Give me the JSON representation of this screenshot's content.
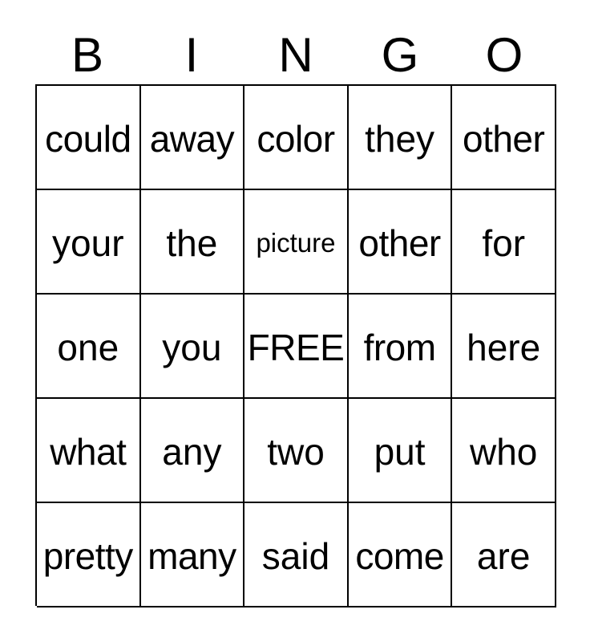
{
  "card": {
    "header_letters": [
      "B",
      "I",
      "N",
      "G",
      "O"
    ],
    "free_space_label": "FREE",
    "colors": {
      "background": "#ffffff",
      "border": "#000000",
      "text": "#000000"
    },
    "rows": [
      [
        {
          "text": "could",
          "size": "tight"
        },
        {
          "text": "away",
          "size": "tight"
        },
        {
          "text": "color",
          "size": "tight"
        },
        {
          "text": "they",
          "size": "normal"
        },
        {
          "text": "other",
          "size": "tight"
        }
      ],
      [
        {
          "text": "your",
          "size": "normal"
        },
        {
          "text": "the",
          "size": "normal"
        },
        {
          "text": "picture",
          "size": "shrink"
        },
        {
          "text": "other",
          "size": "tight"
        },
        {
          "text": "for",
          "size": "normal"
        }
      ],
      [
        {
          "text": "one",
          "size": "normal"
        },
        {
          "text": "you",
          "size": "normal"
        },
        {
          "text": "FREE",
          "size": "tight"
        },
        {
          "text": "from",
          "size": "tight"
        },
        {
          "text": "here",
          "size": "normal"
        }
      ],
      [
        {
          "text": "what",
          "size": "tight"
        },
        {
          "text": "any",
          "size": "normal"
        },
        {
          "text": "two",
          "size": "normal"
        },
        {
          "text": "put",
          "size": "normal"
        },
        {
          "text": "who",
          "size": "normal"
        }
      ],
      [
        {
          "text": "pretty",
          "size": "tight"
        },
        {
          "text": "many",
          "size": "tight"
        },
        {
          "text": "said",
          "size": "normal"
        },
        {
          "text": "come",
          "size": "tight"
        },
        {
          "text": "are",
          "size": "normal"
        }
      ]
    ]
  }
}
